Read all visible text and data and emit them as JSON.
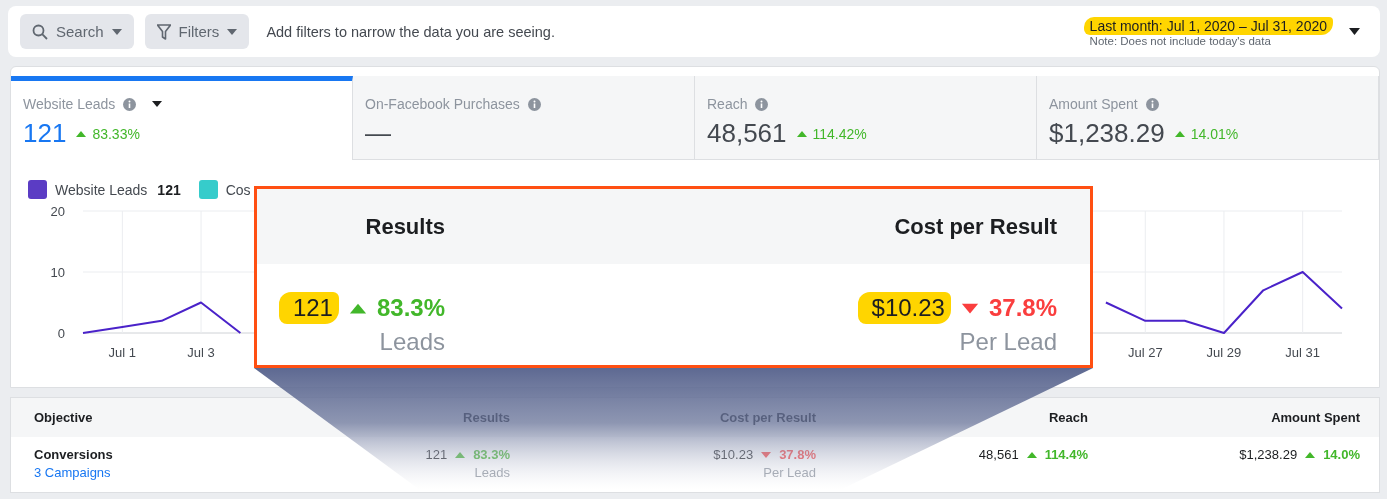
{
  "filter_bar": {
    "search_label": "Search",
    "filters_label": "Filters",
    "hint": "Add filters to narrow the data you are seeing.",
    "date_range": "Last month: Jul 1, 2020 – Jul 31, 2020",
    "date_highlighted": true,
    "date_note": "Note: Does not include today's data"
  },
  "metric_tabs": [
    {
      "label": "Website Leads",
      "value": "121",
      "change": "83.33%",
      "rising": true,
      "selected": true,
      "has_menu": true
    },
    {
      "label": "On-Facebook Purchases",
      "value": "—",
      "selected": false,
      "has_menu": false
    },
    {
      "label": "Reach",
      "value": "48,561",
      "change": "114.42%",
      "rising": true,
      "selected": false,
      "has_menu": false
    },
    {
      "label": "Amount Spent",
      "value": "$1,238.29",
      "change": "14.01%",
      "rising": true,
      "selected": false,
      "has_menu": false
    }
  ],
  "chart": {
    "legend": [
      {
        "label": "Website Leads",
        "value": "121",
        "color": "#5b3cc4"
      },
      {
        "label": "Cos",
        "color": "#36cccb"
      }
    ],
    "chart_data": {
      "type": "line",
      "categories": [
        null,
        "Jul 1",
        null,
        "Jul 3",
        null,
        null,
        null,
        null,
        null,
        null,
        null,
        null,
        null,
        null,
        null,
        null,
        null,
        null,
        null,
        null,
        null,
        null,
        null,
        null,
        null,
        null,
        null,
        "Jul 27",
        null,
        "Jul 29",
        null,
        "Jul 31",
        null
      ],
      "ylim": [
        0,
        20
      ],
      "yticks": [
        0,
        10,
        20
      ],
      "grid": true,
      "series": [
        {
          "color": "#4a22c9",
          "values": [
            0,
            1,
            2,
            5,
            0,
            null,
            null,
            null,
            null,
            null,
            null,
            null,
            null,
            null,
            null,
            null,
            null,
            null,
            null,
            null,
            null,
            null,
            null,
            null,
            null,
            null,
            5,
            2,
            2,
            0,
            7,
            10,
            4
          ]
        }
      ]
    }
  },
  "callout": {
    "columns": [
      {
        "heading": "Results",
        "value": "121",
        "highlighted": true,
        "change": "83.3%",
        "rising": true,
        "unit": "Leads"
      },
      {
        "heading": "Cost per Result",
        "value": "$10.23",
        "highlighted": true,
        "change": "37.8%",
        "rising": false,
        "unit": "Per Lead"
      }
    ]
  },
  "table": {
    "columns": [
      "Objective",
      "Results",
      "Cost per Result",
      "Reach",
      "Amount Spent"
    ],
    "rows": [
      {
        "cells": [
          {
            "value": "Conversions",
            "link": "3 Campaigns"
          },
          {
            "value": "121",
            "change": "83.3%",
            "rising": true,
            "unit": "Leads"
          },
          {
            "value": "$10.23",
            "change": "37.8%",
            "rising": false,
            "unit": "Per Lead"
          },
          {
            "value": "48,561",
            "change": "114.4%",
            "rising": true
          },
          {
            "value": "$1,238.29",
            "change": "14.0%",
            "rising": true
          }
        ]
      }
    ]
  }
}
